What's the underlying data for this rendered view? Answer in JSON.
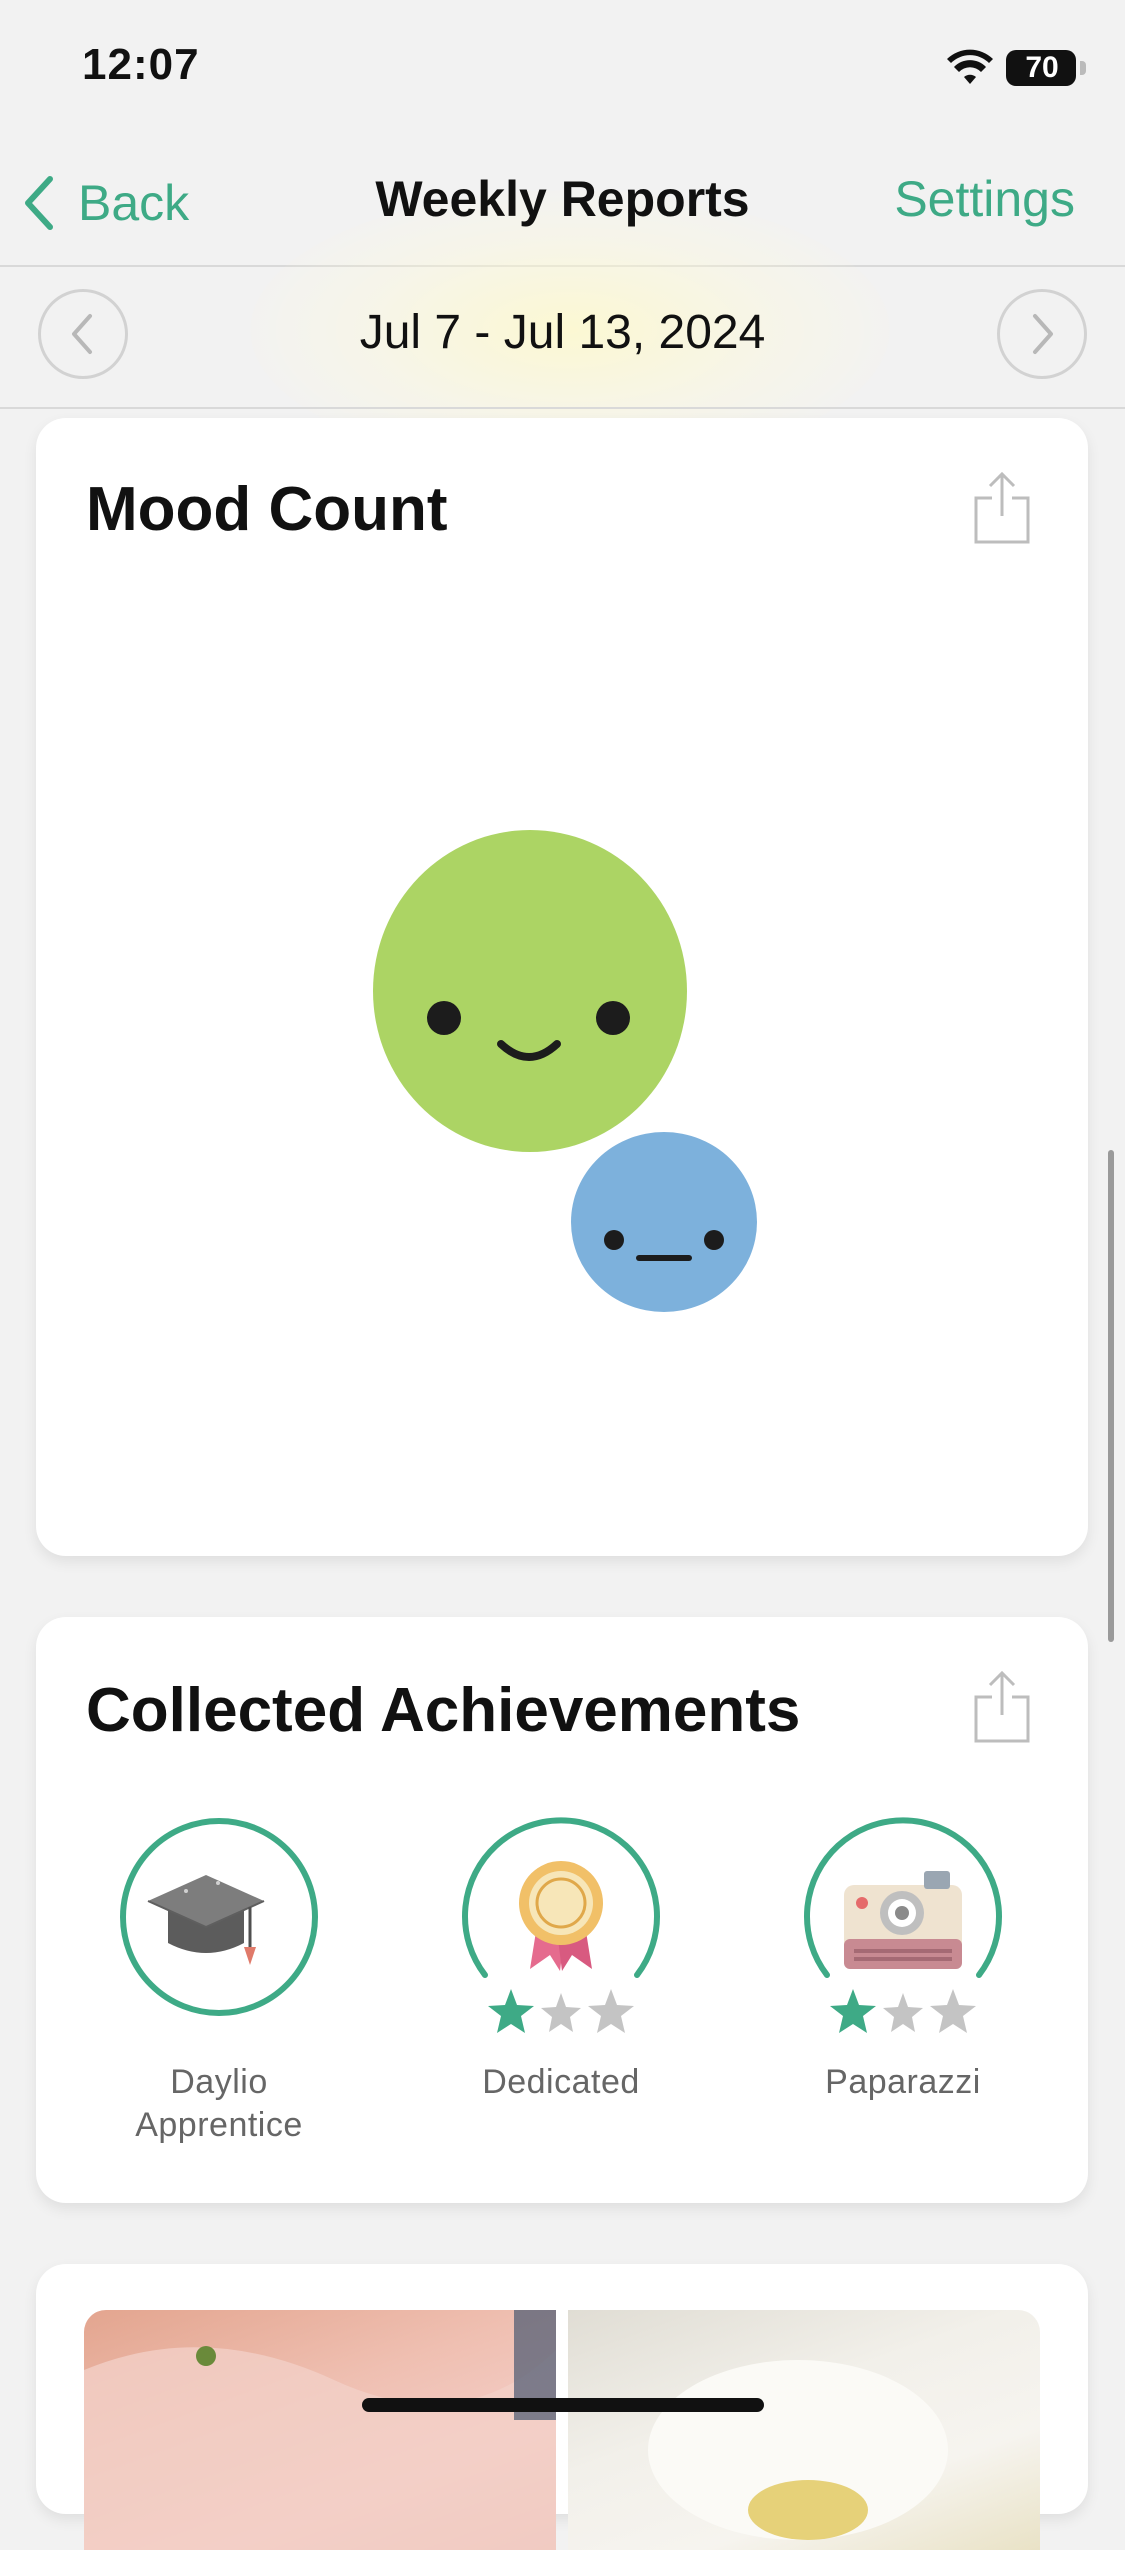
{
  "status_bar": {
    "time": "12:07",
    "battery_level": "70"
  },
  "nav": {
    "back_label": "Back",
    "title": "Weekly Reports",
    "settings_label": "Settings"
  },
  "date_bar": {
    "range": "Jul 7 - Jul 13, 2024"
  },
  "mood_count": {
    "title": "Mood Count",
    "moods": [
      {
        "mood": "good",
        "color": "#acd464"
      },
      {
        "mood": "meh",
        "color": "#7db1dc"
      }
    ]
  },
  "achievements": {
    "title": "Collected Achievements",
    "items": [
      {
        "name": "Daylio Apprentice",
        "line1": "Daylio",
        "line2": "Apprentice",
        "icon": "graduation-cap-icon"
      },
      {
        "name": "Dedicated",
        "line1": "Dedicated",
        "icon": "award-ribbon-icon",
        "stars_earned": 1,
        "stars_total": 3
      },
      {
        "name": "Paparazzi",
        "line1": "Paparazzi",
        "icon": "instant-camera-icon",
        "stars_earned": 1,
        "stars_total": 3
      }
    ]
  },
  "colors": {
    "accent": "#3eaa86",
    "star_earned": "#3eaa86",
    "star_unearned": "#c4c4c4"
  }
}
